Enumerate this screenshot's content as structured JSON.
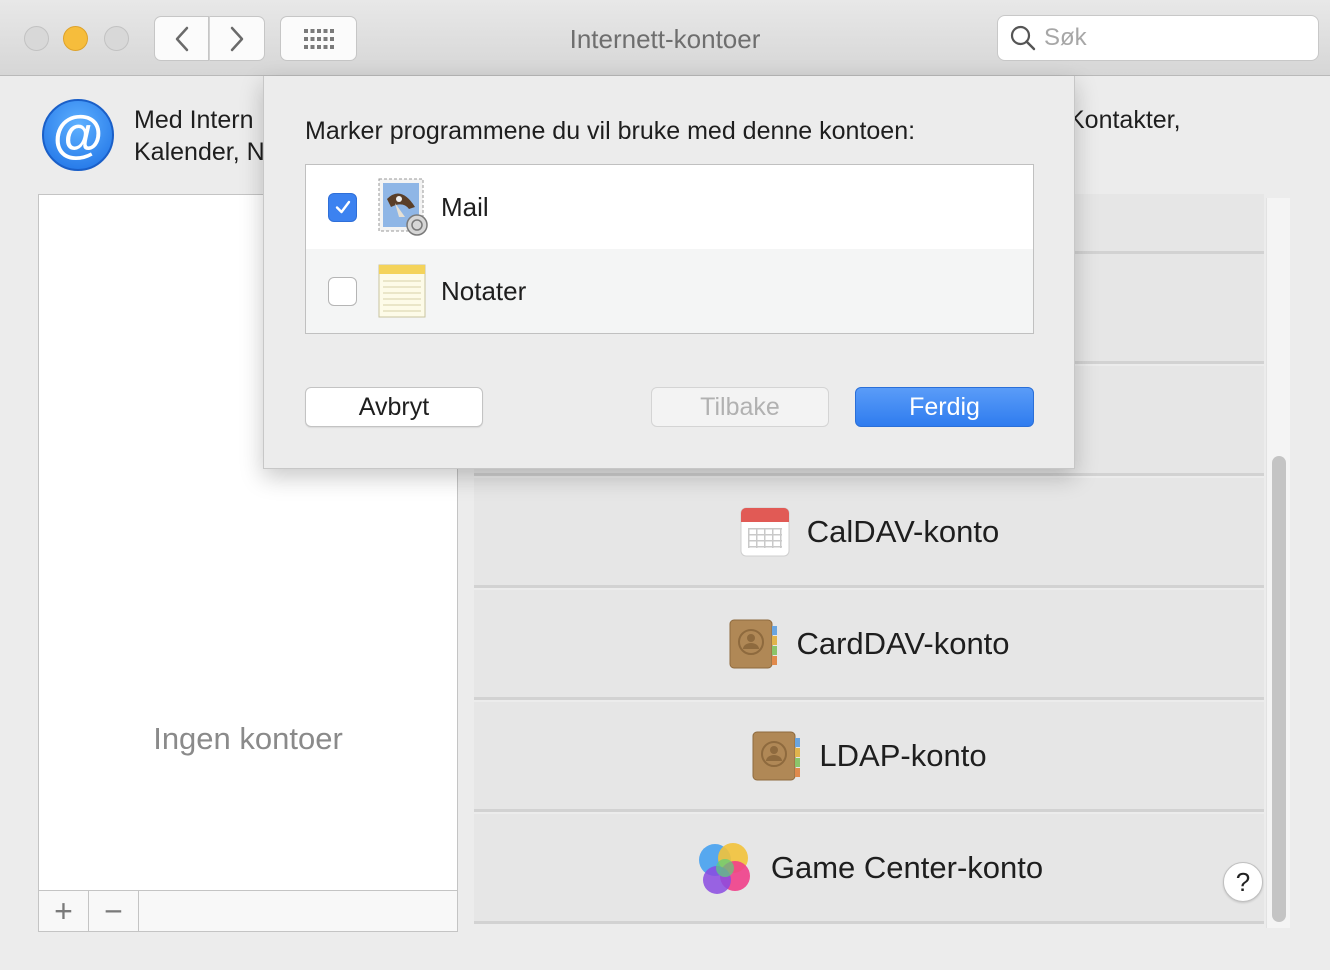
{
  "window": {
    "title": "Internett-kontoer"
  },
  "search": {
    "placeholder": "Søk"
  },
  "header": {
    "line1_left": "Med Intern",
    "line2_left": "Kalender, N",
    "line1_right": "Kontakter,"
  },
  "accounts": {
    "empty_label": "Ingen kontoer",
    "add": "+",
    "remove": "−"
  },
  "providers": [
    {
      "label": "CalDAV-konto",
      "icon": "calendar-icon"
    },
    {
      "label": "CardDAV-konto",
      "icon": "contacts-icon"
    },
    {
      "label": "LDAP-konto",
      "icon": "contacts-icon"
    },
    {
      "label": "Game Center-konto",
      "icon": "game-center-icon"
    }
  ],
  "help": {
    "label": "?"
  },
  "sheet": {
    "prompt": "Marker programmene du vil bruke med denne kontoen:",
    "apps": [
      {
        "label": "Mail",
        "checked": true,
        "icon": "mail-icon"
      },
      {
        "label": "Notater",
        "checked": false,
        "icon": "notes-icon"
      }
    ],
    "cancel": "Avbryt",
    "back": "Tilbake",
    "done": "Ferdig"
  },
  "colors": {
    "accent": "#3c82f0",
    "minimize": "#f6bd3c"
  }
}
